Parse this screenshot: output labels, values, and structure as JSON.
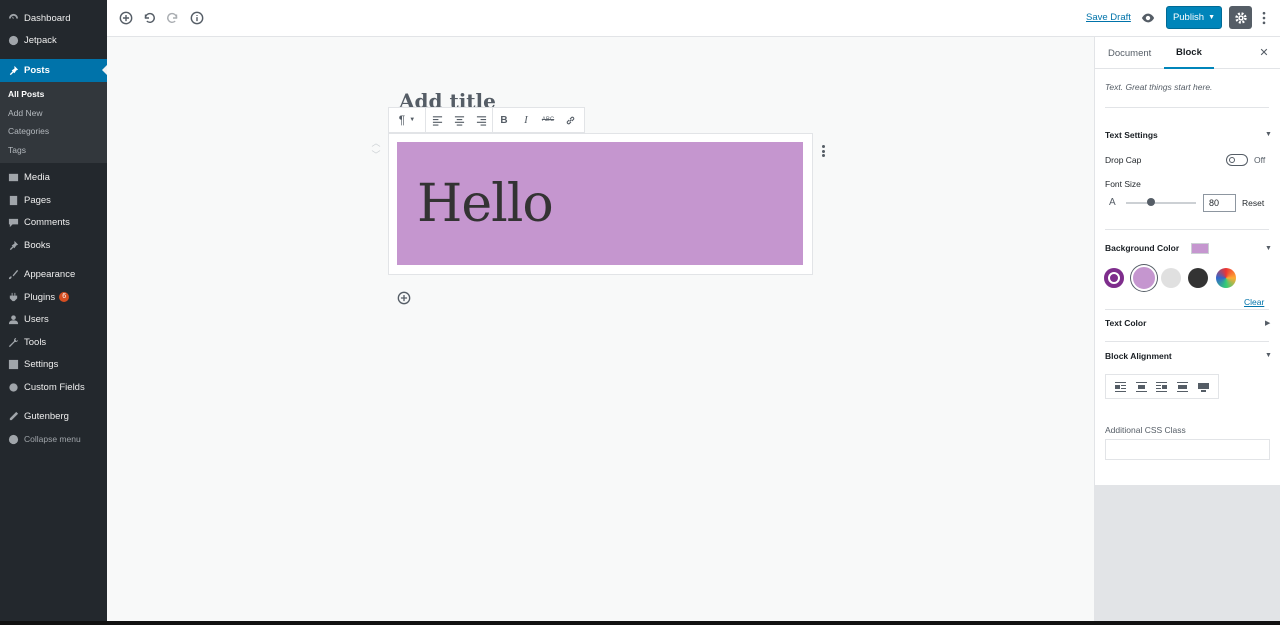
{
  "sidebar": {
    "items": [
      {
        "label": "Dashboard",
        "icon": "dashboard-icon"
      },
      {
        "label": "Jetpack",
        "icon": "jetpack-icon"
      },
      {
        "label": "Posts",
        "icon": "pin-icon",
        "active": true
      },
      {
        "label": "Media",
        "icon": "media-icon"
      },
      {
        "label": "Pages",
        "icon": "pages-icon"
      },
      {
        "label": "Comments",
        "icon": "comments-icon"
      },
      {
        "label": "Books",
        "icon": "pin-icon"
      },
      {
        "label": "Appearance",
        "icon": "brush-icon"
      },
      {
        "label": "Plugins",
        "icon": "plugin-icon",
        "badge": "6"
      },
      {
        "label": "Users",
        "icon": "users-icon"
      },
      {
        "label": "Tools",
        "icon": "wrench-icon"
      },
      {
        "label": "Settings",
        "icon": "settings-icon"
      },
      {
        "label": "Custom Fields",
        "icon": "gear-icon"
      },
      {
        "label": "Gutenberg",
        "icon": "pencil-icon"
      },
      {
        "label": "Collapse menu",
        "icon": "collapse-icon"
      }
    ],
    "posts_submenu": [
      "All Posts",
      "Add New",
      "Categories",
      "Tags"
    ]
  },
  "topbar": {
    "save_draft": "Save Draft",
    "publish": "Publish",
    "icons": [
      "add-block-icon",
      "undo-icon",
      "redo-icon",
      "info-icon",
      "preview-eye-icon",
      "settings-gear-icon",
      "more-vertical-icon"
    ]
  },
  "editor": {
    "title_placeholder": "Add title",
    "paragraph_text": "Hello",
    "block_background": "#c596cf",
    "toolbar_icons": [
      "paragraph-icon",
      "align-left-icon",
      "align-center-icon",
      "align-right-icon",
      "bold-icon",
      "italic-icon",
      "strikethrough-icon",
      "link-icon"
    ]
  },
  "panel": {
    "tabs": [
      "Document",
      "Block"
    ],
    "active_tab": "Block",
    "description": "Text. Great things start here.",
    "text_settings": "Text Settings",
    "drop_cap": "Drop Cap",
    "drop_cap_state": "Off",
    "font_size": "Font Size",
    "font_size_letter": "A",
    "font_size_value": "80",
    "reset": "Reset",
    "background_color": "Background Color",
    "clear": "Clear",
    "text_color": "Text Color",
    "block_alignment": "Block Alignment",
    "additional_css": "Additional CSS Class",
    "palette": [
      "#7e2d8c",
      "#c596cf",
      "#e0e0e0",
      "#333333",
      "#d9a44a"
    ]
  }
}
